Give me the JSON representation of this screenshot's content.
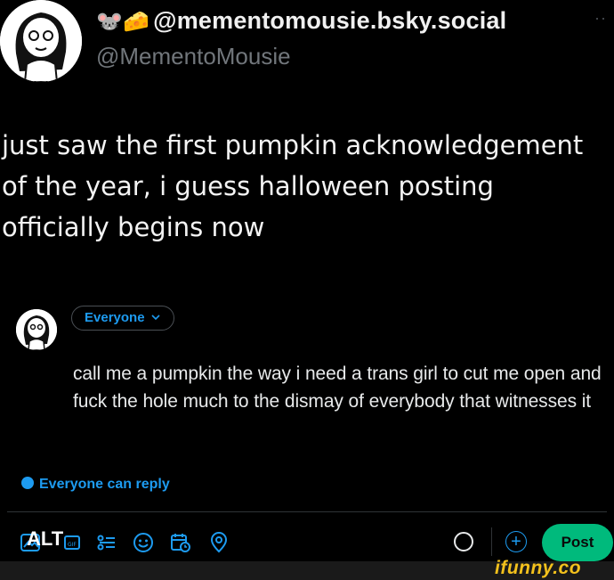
{
  "author": {
    "emoji_prefix": "🐭🧀",
    "display_name": "@mementomousie.bsky.social",
    "handle": "@MementoMousie",
    "more_icon": "ellipsis-icon"
  },
  "post": {
    "text": "just saw the first pumpkin acknowledgement\nof the year, i guess halloween posting\nofficially begins now"
  },
  "compose": {
    "audience_label": "Everyone",
    "text": "call me a pumpkin the way i need a trans girl to cut me open and fuck the hole much to the dismay of everybody that witnesses it",
    "reply_setting": "Everyone can reply"
  },
  "toolbar": {
    "alt_label": "ALT",
    "icons": [
      "image-icon",
      "gif-icon",
      "poll-icon",
      "emoji-icon",
      "schedule-icon",
      "location-icon"
    ],
    "post_label": "Post"
  },
  "watermark": {
    "text": "ifunny.co"
  },
  "colors": {
    "accent": "#1d9bf0",
    "post_button": "#00ba7c",
    "watermark": "#f3c11c"
  }
}
